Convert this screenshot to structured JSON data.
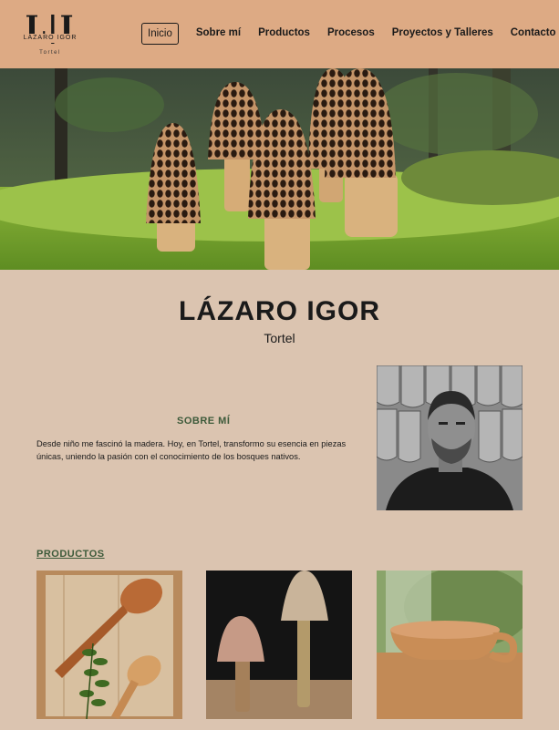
{
  "header": {
    "logo": {
      "mark": "L|I",
      "name": "LÁZARO IGOR",
      "sub": "Tortel"
    },
    "nav": [
      {
        "label": "Inicio",
        "active": true
      },
      {
        "label": "Sobre mí"
      },
      {
        "label": "Productos"
      },
      {
        "label": "Procesos"
      },
      {
        "label": "Proyectos y Talleres"
      },
      {
        "label": "Contacto"
      }
    ]
  },
  "hero": {
    "image": "carved wooden morel mushrooms on moss"
  },
  "intro": {
    "title": "LÁZARO IGOR",
    "subtitle": "Tortel"
  },
  "about": {
    "heading": "SOBRE MÍ",
    "text": "Desde niño me fascinó la madera. Hoy, en Tortel, transformo su esencia en piezas únicas, uniendo la pasión con el conocimiento de los bosques nativos.",
    "portrait": "black and white portrait"
  },
  "products": {
    "heading": "PRODUCTOS",
    "items": [
      {
        "image": "wooden spoons with greenery"
      },
      {
        "image": "carved wooden mushrooms"
      },
      {
        "image": "wooden kuksa cup"
      }
    ]
  },
  "colors": {
    "header_bg": "#ddaa84",
    "page_bg": "#dbc4b0",
    "accent_green": "#3d5a3a"
  }
}
